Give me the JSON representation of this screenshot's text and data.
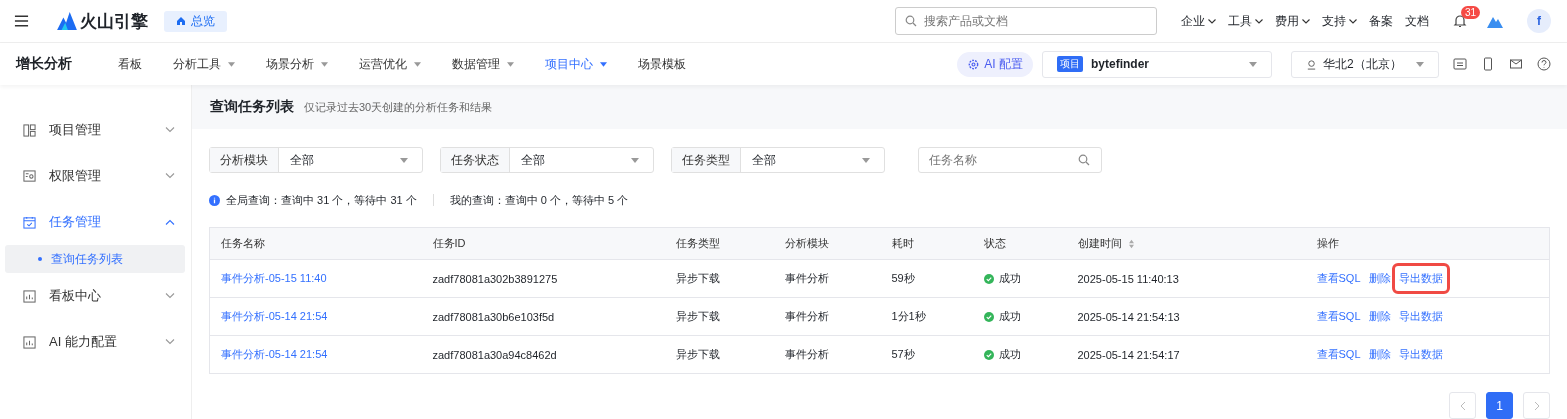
{
  "header": {
    "brand": "火山引擎",
    "overview": "总览",
    "search_placeholder": "搜索产品或文档",
    "links": [
      {
        "label": "企业",
        "dropdown": true
      },
      {
        "label": "工具",
        "dropdown": true
      },
      {
        "label": "费用",
        "dropdown": true
      },
      {
        "label": "支持",
        "dropdown": true
      },
      {
        "label": "备案",
        "dropdown": false
      },
      {
        "label": "文档",
        "dropdown": false
      }
    ],
    "notification_count": "31",
    "avatar": "f"
  },
  "subnav": {
    "title": "增长分析",
    "items": [
      {
        "label": "看板",
        "dropdown": false,
        "selected": false
      },
      {
        "label": "分析工具",
        "dropdown": true,
        "selected": false
      },
      {
        "label": "场景分析",
        "dropdown": true,
        "selected": false
      },
      {
        "label": "运营优化",
        "dropdown": true,
        "selected": false
      },
      {
        "label": "数据管理",
        "dropdown": true,
        "selected": false
      },
      {
        "label": "项目中心",
        "dropdown": true,
        "selected": true
      },
      {
        "label": "场景模板",
        "dropdown": false,
        "selected": false
      }
    ],
    "ai_button": "AI 配置",
    "project_tag": "项目",
    "project": "bytefinder",
    "region": "华北2（北京）"
  },
  "sidebar": {
    "items": [
      {
        "label": "项目管理",
        "expanded": false,
        "selected": false
      },
      {
        "label": "权限管理",
        "expanded": false,
        "selected": false
      },
      {
        "label": "任务管理",
        "expanded": true,
        "selected": true,
        "children": [
          {
            "label": "查询任务列表",
            "selected": true
          }
        ]
      },
      {
        "label": "看板中心",
        "expanded": false,
        "selected": false
      },
      {
        "label": "AI 能力配置",
        "expanded": false,
        "selected": false
      }
    ]
  },
  "page": {
    "title": "查询任务列表",
    "subtitle": "仅记录过去30天创建的分析任务和结果"
  },
  "filters": [
    {
      "label": "分析模块",
      "value": "全部"
    },
    {
      "label": "任务状态",
      "value": "全部"
    },
    {
      "label": "任务类型",
      "value": "全部"
    }
  ],
  "name_search": {
    "placeholder": "任务名称"
  },
  "summary": {
    "global": "全局查询：查询中 31 个，等待中 31 个",
    "mine": "我的查询：查询中 0 个，等待中 5 个"
  },
  "table": {
    "columns": [
      {
        "label": "任务名称",
        "sortable": false
      },
      {
        "label": "任务ID",
        "sortable": false
      },
      {
        "label": "任务类型",
        "sortable": false
      },
      {
        "label": "分析模块",
        "sortable": false
      },
      {
        "label": "耗时",
        "sortable": false
      },
      {
        "label": "状态",
        "sortable": false
      },
      {
        "label": "创建时间",
        "sortable": true
      },
      {
        "label": "操作",
        "sortable": false
      }
    ],
    "rows": [
      {
        "name": "事件分析-05-15 11:40",
        "id": "zadf78081a302b3891275",
        "type": "异步下载",
        "module": "事件分析",
        "duration": "59秒",
        "status": "成功",
        "created": "2025-05-15 11:40:13",
        "actions": [
          {
            "label": "查看SQL",
            "highlighted": false
          },
          {
            "label": "删除",
            "highlighted": false
          },
          {
            "label": "导出数据",
            "highlighted": true
          }
        ]
      },
      {
        "name": "事件分析-05-14 21:54",
        "id": "zadf78081a30b6e103f5d",
        "type": "异步下载",
        "module": "事件分析",
        "duration": "1分1秒",
        "status": "成功",
        "created": "2025-05-14 21:54:13",
        "actions": [
          {
            "label": "查看SQL",
            "highlighted": false
          },
          {
            "label": "删除",
            "highlighted": false
          },
          {
            "label": "导出数据",
            "highlighted": false
          }
        ]
      },
      {
        "name": "事件分析-05-14 21:54",
        "id": "zadf78081a30a94c8462d",
        "type": "异步下载",
        "module": "事件分析",
        "duration": "57秒",
        "status": "成功",
        "created": "2025-05-14 21:54:17",
        "actions": [
          {
            "label": "查看SQL",
            "highlighted": false
          },
          {
            "label": "删除",
            "highlighted": false
          },
          {
            "label": "导出数据",
            "highlighted": false
          }
        ]
      }
    ]
  },
  "pagination": {
    "pages": [
      {
        "label": "1",
        "selected": true
      }
    ]
  }
}
